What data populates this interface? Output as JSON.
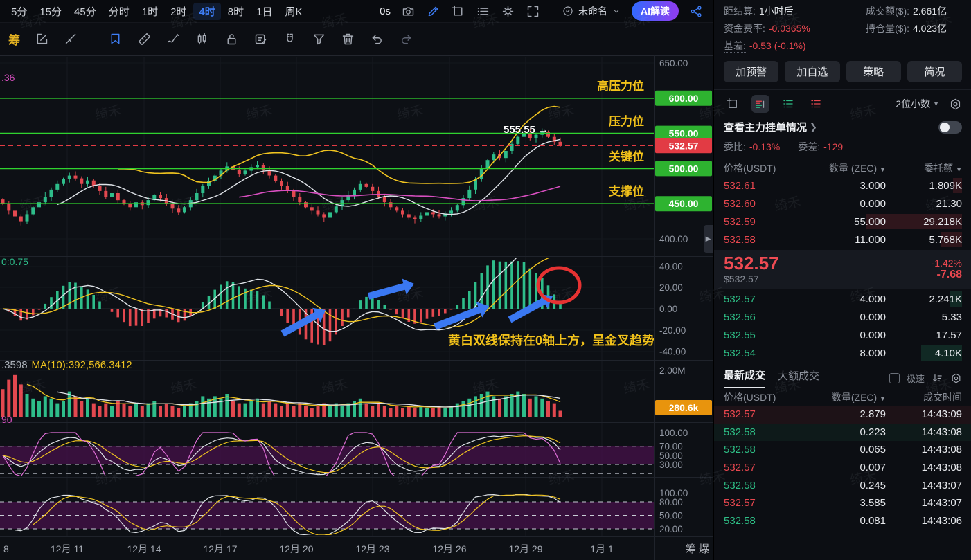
{
  "watermark": {
    "text": "绮禾"
  },
  "top_toolbar": {
    "timeframes": [
      "5分",
      "15分",
      "45分",
      "分时",
      "1时",
      "2时",
      "4时",
      "8时",
      "1日",
      "周K"
    ],
    "active_timeframe": "4时",
    "countdown": "0s",
    "chart_name": "未命名",
    "ai_button": "AI解读"
  },
  "draw_toolbar": {
    "chip_label": "筹"
  },
  "chart": {
    "pane1": {
      "left_label": ".36",
      "tick_top": "650.00",
      "tick_bottom": "400.00",
      "level_badges": [
        "600.00",
        "550.00",
        "500.00",
        "450.00"
      ],
      "price_badge": "532.57",
      "level_labels": [
        "高压力位",
        "压力位",
        "关键位",
        "支撑位"
      ],
      "price_callout": "555.55 →"
    },
    "pane2": {
      "left_label": "0:0.75",
      "ticks": [
        "40.00",
        "20.00",
        "0.00",
        "-20.00",
        "-40.00"
      ],
      "note": "黄白双线保持在0轴上方，呈金叉趋势"
    },
    "pane3": {
      "left_label_gray": ".3598",
      "left_label_yellow": "MA(10):392,566.3412",
      "tick": "2.00M",
      "badge": "280.6k"
    },
    "pane4": {
      "left_label": "90",
      "ticks": [
        "100.00",
        "70.00",
        "50.00",
        "30.00"
      ]
    },
    "pane5": {
      "ticks": [
        "100.00",
        "80.00",
        "50.00",
        "20.00"
      ]
    },
    "x_axis": {
      "labels": [
        "8",
        "12月 11",
        "12月 14",
        "12月 17",
        "12月 20",
        "12月 23",
        "12月 26",
        "12月 29",
        "1月 1"
      ],
      "right_text": "筹 爆"
    }
  },
  "chart_data": {
    "type": "candlestick",
    "interval": "4时",
    "y_range_price": [
      400,
      650
    ],
    "resistance_support_levels": [
      600,
      550,
      500,
      450
    ],
    "last_price": 532.57,
    "marked_high": 555.55,
    "macd_axis_range": [
      -40,
      40
    ],
    "volume_axis_top_m": 2.0,
    "last_volume_label": "280.6k",
    "closes": [
      450,
      440,
      432,
      425,
      435,
      445,
      452,
      460,
      470,
      478,
      485,
      490,
      486,
      478,
      483,
      475,
      468,
      460,
      465,
      455,
      450,
      445,
      452,
      448,
      455,
      462,
      458,
      450,
      443,
      438,
      445,
      455,
      465,
      475,
      482,
      490,
      497,
      503,
      498,
      492,
      497,
      502,
      505,
      498,
      490,
      482,
      475,
      468,
      460,
      452,
      445,
      440,
      435,
      430,
      438,
      446,
      455,
      462,
      470,
      478,
      474,
      468,
      460,
      452,
      445,
      440,
      435,
      430,
      428,
      433,
      438,
      435,
      432,
      436,
      440,
      448,
      458,
      470,
      485,
      500,
      512,
      520,
      515,
      525,
      535,
      545,
      550,
      543,
      548,
      552,
      545,
      538,
      533
    ],
    "volumes_m": [
      1.2,
      1.6,
      1.8,
      1.4,
      1.0,
      0.8,
      0.7,
      0.9,
      0.8,
      0.6,
      0.7,
      1.1,
      0.9,
      0.7,
      0.8,
      0.6,
      0.5,
      0.6,
      0.5,
      0.7,
      0.6,
      0.5,
      0.6,
      0.5,
      0.6,
      0.7,
      0.5,
      0.6,
      0.5,
      0.4,
      0.5,
      0.6,
      0.7,
      0.9,
      0.8,
      0.9,
      0.8,
      1.0,
      0.7,
      0.6,
      0.6,
      0.7,
      0.8,
      0.6,
      0.7,
      0.6,
      0.5,
      0.6,
      0.5,
      0.6,
      0.5,
      0.4,
      0.5,
      0.6,
      0.5,
      0.6,
      0.5,
      0.6,
      0.7,
      0.8,
      0.6,
      0.5,
      0.6,
      0.5,
      0.4,
      0.5,
      0.4,
      0.5,
      0.4,
      0.5,
      0.4,
      0.4,
      0.5,
      0.4,
      0.5,
      0.6,
      0.7,
      0.8,
      0.9,
      1.0,
      1.1,
      0.9,
      0.8,
      0.9,
      1.0,
      1.1,
      1.0,
      0.8,
      0.9,
      0.8,
      0.7,
      0.6,
      0.28
    ]
  },
  "panel": {
    "stats": {
      "settle_label": "距结算:",
      "settle_value": "1小时后",
      "turnover_label": "成交额($):",
      "turnover_value": "2.661亿",
      "funding_label": "资金费率:",
      "funding_value": "-0.0365%",
      "oi_label": "持仓量($):",
      "oi_value": "4.023亿",
      "basis_label": "基差:",
      "basis_value": "-0.53 (-0.1%)"
    },
    "buttons": [
      "加预警",
      "加自选",
      "策略",
      "简况"
    ],
    "precision": "2位小数",
    "main_orders_link": "查看主力挂单情况",
    "ratio_label": "委比:",
    "ratio_value": "-0.13%",
    "diff_label": "委差:",
    "diff_value": "-129",
    "orderbook": {
      "headers": [
        "价格(USDT)",
        "数量 (ZEC)",
        "委托额"
      ],
      "asks": [
        {
          "price": "532.61",
          "qty": "3.000",
          "amount": "1.809K",
          "depth": 0.04
        },
        {
          "price": "532.60",
          "qty": "0.000",
          "amount": "21.30",
          "depth": 0.0
        },
        {
          "price": "532.59",
          "qty": "55.000",
          "amount": "29.218K",
          "depth": 0.42
        },
        {
          "price": "532.58",
          "qty": "11.000",
          "amount": "5.768K",
          "depth": 0.09
        }
      ],
      "last": {
        "price": "532.57",
        "usd": "$532.57",
        "change_pct": "-1.42%",
        "change_abs": "-7.68"
      },
      "bids": [
        {
          "price": "532.57",
          "qty": "4.000",
          "amount": "2.241K",
          "depth": 0.05
        },
        {
          "price": "532.56",
          "qty": "0.000",
          "amount": "5.33",
          "depth": 0.0
        },
        {
          "price": "532.55",
          "qty": "0.000",
          "amount": "17.57",
          "depth": 0.0
        },
        {
          "price": "532.54",
          "qty": "8.000",
          "amount": "4.10K",
          "depth": 0.18
        }
      ]
    },
    "trades": {
      "tab_latest": "最新成交",
      "tab_large": "大额成交",
      "fast_label": "极速",
      "headers": [
        "价格(USDT)",
        "数量(ZEC)",
        "成交时间"
      ],
      "rows": [
        {
          "price": "532.57",
          "side": "sell",
          "qty": "2.879",
          "time": "14:43:09"
        },
        {
          "price": "532.58",
          "side": "buy",
          "qty": "0.223",
          "time": "14:43:08"
        },
        {
          "price": "532.58",
          "side": "buy",
          "qty": "0.065",
          "time": "14:43:08"
        },
        {
          "price": "532.57",
          "side": "sell",
          "qty": "0.007",
          "time": "14:43:08"
        },
        {
          "price": "532.58",
          "side": "buy",
          "qty": "0.245",
          "time": "14:43:07"
        },
        {
          "price": "532.57",
          "side": "sell",
          "qty": "3.585",
          "time": "14:43:07"
        },
        {
          "price": "532.58",
          "side": "buy",
          "qty": "0.081",
          "time": "14:43:06"
        }
      ]
    }
  }
}
